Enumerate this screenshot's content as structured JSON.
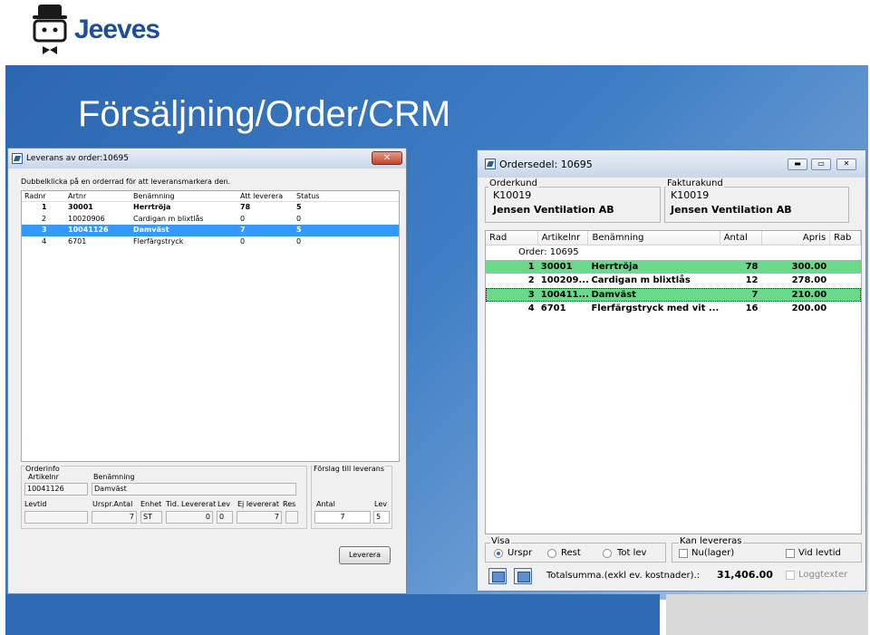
{
  "brand": {
    "name": "Jeeves"
  },
  "slide_title": "Försäljning/Order/CRM",
  "left_window": {
    "title": "Leverans av order:10695",
    "close_label": "✕",
    "hint": "Dubbelklicka på en orderrad för att leveransmarkera den.",
    "columns": [
      "Radnr",
      "Artnr",
      "Benämning",
      "Att leverera",
      "Status"
    ],
    "rows": [
      {
        "radnr": "1",
        "artnr": "30001",
        "benamning": "Herrtröja",
        "att_leverera": "78",
        "status": "5"
      },
      {
        "radnr": "2",
        "artnr": "10020906",
        "benamning": "Cardigan m blixtlås",
        "att_leverera": "0",
        "status": "0"
      },
      {
        "radnr": "3",
        "artnr": "10041126",
        "benamning": "Damväst",
        "att_leverera": "7",
        "status": "5"
      },
      {
        "radnr": "4",
        "artnr": "6701",
        "benamning": "Flerfärgstryck",
        "att_leverera": "0",
        "status": "0"
      }
    ],
    "orderinfo": {
      "group_label": "Orderinfo",
      "artikelnr_label": "Artikelnr",
      "artikelnr_value": "10041126",
      "benamning_label": "Benämning",
      "benamning_value": "Damväst",
      "levtid_label": "Levtid",
      "levtid_value": "",
      "urspr_antal_label": "Urspr.Antal",
      "urspr_antal_value": "7",
      "enhet_label": "Enhet",
      "enhet_value": "ST",
      "tid_levererat_label": "Tid. Levererat",
      "tid_levererat_value": "0",
      "lev_label": "Lev",
      "lev_value": "0",
      "ej_levererat_label": "Ej levererat",
      "ej_levererat_value": "7",
      "res_label": "Res",
      "res_value": ""
    },
    "forslag": {
      "group_label": "Förslag till leverans",
      "antal_label": "Antal",
      "antal_value": "7",
      "lev_label": "Lev",
      "lev_value": "5"
    },
    "leverera_button": "Leverera"
  },
  "right_window": {
    "title": "Ordersedel: 10695",
    "orderkund": {
      "label": "Orderkund",
      "id": "K10019",
      "name": "Jensen Ventilation AB"
    },
    "fakturakund": {
      "label": "Fakturakund",
      "id": "K10019",
      "name": "Jensen Ventilation AB"
    },
    "columns": [
      "Rad",
      "Artikelnr",
      "Benämning",
      "Antal",
      "Apris",
      "Rab"
    ],
    "order_node": "Order: 10695",
    "rows": [
      {
        "rad": "1",
        "artikelnr": "30001",
        "benamning": "Herrtröja",
        "antal": "78",
        "apris": "300.00",
        "state": "green"
      },
      {
        "rad": "2",
        "artikelnr": "100209...",
        "benamning": "Cardigan m blixtlås",
        "antal": "12",
        "apris": "278.00",
        "state": "none"
      },
      {
        "rad": "3",
        "artikelnr": "100411...",
        "benamning": "Damväst",
        "antal": "7",
        "apris": "210.00",
        "state": "green-selected"
      },
      {
        "rad": "4",
        "artikelnr": "6701",
        "benamning": "Flerfärgstryck med vit ...",
        "antal": "16",
        "apris": "200.00",
        "state": "none"
      }
    ],
    "visa": {
      "label": "Visa",
      "options": [
        "Urspr",
        "Rest",
        "Tot lev"
      ],
      "selected": "Urspr"
    },
    "kan_levereras": {
      "label": "Kan levereras",
      "nu_lager": "Nu(lager)",
      "vid_levtid": "Vid levtid"
    },
    "totalsumma_label": "Totalsumma.(exkl ev. kostnader).:",
    "totalsumma_value": "31,406.00",
    "loggtexter": "Loggtexter"
  },
  "colors": {
    "banner_blue": "#2c66b0",
    "row_green": "#6bd98b",
    "selection_blue": "#3399ff"
  }
}
